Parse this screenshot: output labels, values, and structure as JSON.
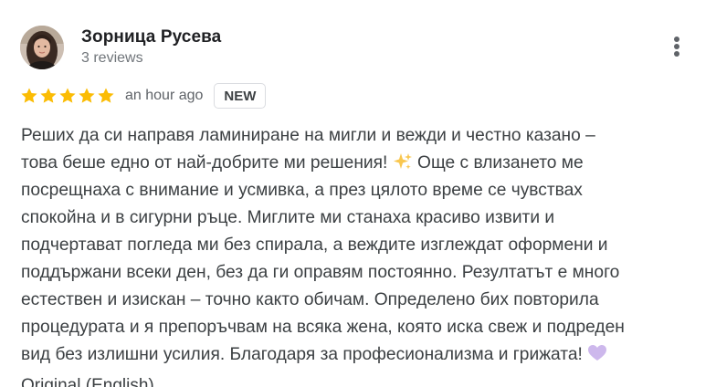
{
  "review": {
    "author": {
      "name": "Зорница Русева",
      "meta": "3 reviews",
      "avatar_icon": "profile-photo-avatar"
    },
    "rating": {
      "stars": 5,
      "max_stars": 5,
      "star_color": "#fbbc04"
    },
    "time": "an hour ago",
    "badge": "NEW",
    "more_icon": "more-vert-icon",
    "text_lines": [
      "Реших да си направя ламиниране на мигли и вежди и честно казано –",
      "това беше едно от най-добрите ми решения!",
      "Още с влизането ме",
      "посрещнаха с внимание и усмивка, а през цялото време се чувствах",
      "спокойна и в сигурни ръце. Миглите ми станаха красиво извити и",
      "подчертават погледа ми без спирала, а веждите изглеждат оформени и",
      "поддържани всеки ден, без да ги оправям постоянно. Резултатът е много",
      "естествен и изискан – точно както обичам. Определено бих повторила",
      "процедурата и я препоръчвам на всяка жена, която иска свеж и подреден",
      "вид без излишни усилия. Благодаря за професионализма и грижата!"
    ],
    "emojis": {
      "sparkle": "sparkles-emoji",
      "heart": "purple-heart-emoji"
    },
    "translation_link": "Original (English)"
  },
  "colors": {
    "text_primary": "#202124",
    "text_secondary": "#70757a",
    "star": "#fbbc04",
    "badge_border": "#dadce0"
  }
}
